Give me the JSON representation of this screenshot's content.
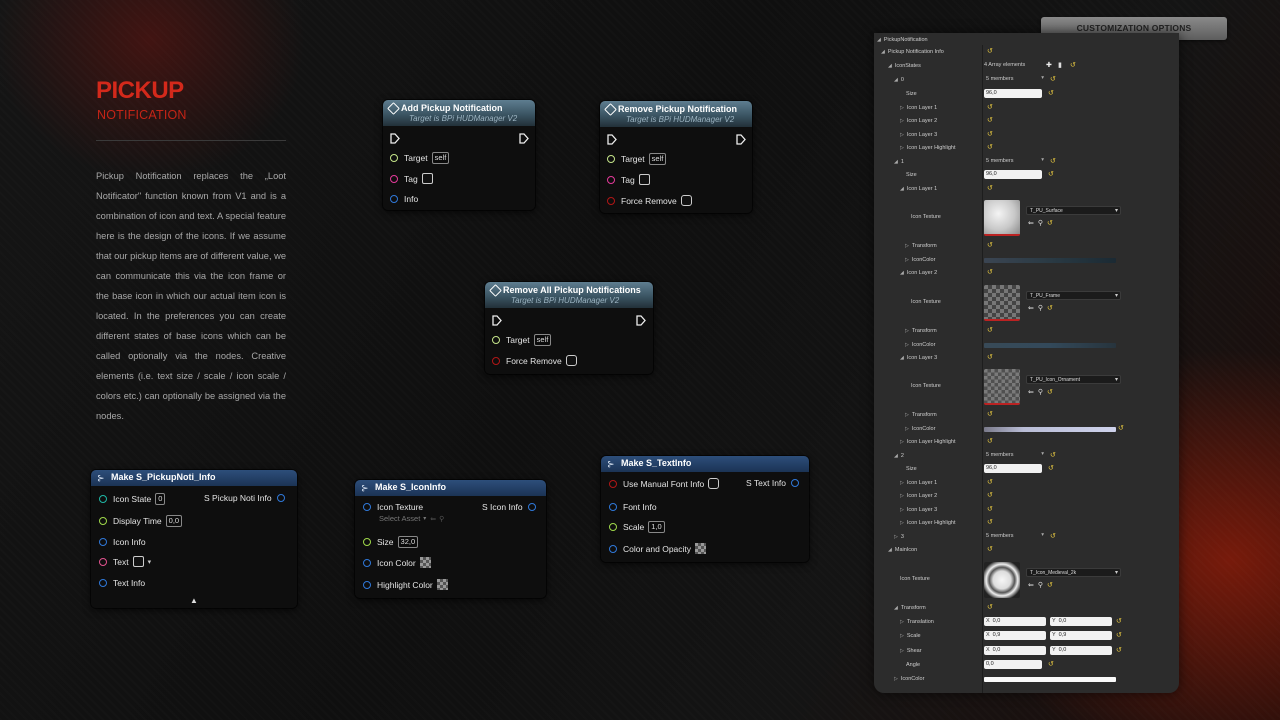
{
  "hero": {
    "title": "PICKUP",
    "subtitle": "NOTIFICATION",
    "description": "Pickup Notification replaces the „Loot Notificator\" function known from V1 and is a combination of icon and text. A special feature here is the design of the icons. If we assume that our pickup items are of different value, we can communicate this via the icon frame or the base icon in which our actual item icon is located. In the preferences you can create different states of base icons which can be called optionally via the nodes. Creative elements (i.e. text size / scale / icon scale / colors etc.) can optionally be assigned via the nodes."
  },
  "nodes": {
    "add": {
      "title": "Add Pickup Notification",
      "subtitle": "Target is BPi HUDManager V2",
      "target": "Target",
      "target_value": "self",
      "tag": "Tag",
      "info": "Info"
    },
    "remove": {
      "title": "Remove Pickup Notification",
      "subtitle": "Target is BPi HUDManager V2",
      "target": "Target",
      "target_value": "self",
      "tag": "Tag",
      "force": "Force Remove"
    },
    "remove_all": {
      "title": "Remove All Pickup Notifications",
      "subtitle": "Target is BPi HUDManager V2",
      "target": "Target",
      "target_value": "self",
      "force": "Force Remove"
    },
    "make_pickup": {
      "title": "Make S_PickupNoti_Info",
      "icon_state": "Icon State",
      "icon_state_value": "0",
      "display_time": "Display Time",
      "display_time_value": "0,0",
      "icon_info": "Icon Info",
      "text": "Text",
      "text_info": "Text Info",
      "output": "S Pickup Noti Info"
    },
    "make_icon": {
      "title": "Make S_IconInfo",
      "icon_texture": "Icon Texture",
      "select_asset": "Select Asset",
      "size": "Size",
      "size_value": "32,0",
      "icon_color": "Icon Color",
      "highlight_color": "Highlight Color",
      "output": "S Icon Info"
    },
    "make_text": {
      "title": "Make S_TextInfo",
      "use_manual": "Use Manual Font Info",
      "font_info": "Font Info",
      "scale": "Scale",
      "scale_value": "1,0",
      "color_opacity": "Color and Opacity",
      "output": "S Text Info"
    }
  },
  "top_button": "CUSTOMIZATION OPTIONS",
  "panel": {
    "header": "PickupNotification",
    "rows": {
      "pni": "Pickup Notification Info",
      "iconstates": "IconStates",
      "iconstates_val": "4 Array elements",
      "s0": "0",
      "s0_val": "5 members",
      "size": "Size",
      "size_val": "96,0",
      "layer1": "Icon Layer 1",
      "layer2": "Icon Layer 2",
      "layer3": "Icon Layer 3",
      "highlight": "Icon Layer Highlight",
      "s1": "1",
      "s1_val": "5 members",
      "icon_texture": "Icon Texture",
      "transform": "Transform",
      "iconcolor": "IconColor",
      "tex_surface": "T_PU_Surface",
      "tex_frame": "T_PU_Frame",
      "tex_orn": "T_PU_Icon_Ornament",
      "s2": "2",
      "s2_val": "5 members",
      "s3": "3",
      "s3_val": "5 members",
      "mainicon": "MainIcon",
      "tex_medieval": "T_Icon_Medieval_2k",
      "translation": "Translation",
      "scale": "Scale",
      "shear": "Shear",
      "angle": "Angle",
      "x": "X",
      "y": "Y",
      "tr_x": "0,0",
      "tr_y": "0,0",
      "sc_x": "0,9",
      "sc_y": "0,9",
      "sh_x": "0,0",
      "sh_y": "0,0",
      "angle_val": "0,0"
    }
  },
  "colors": {
    "accent": "#d3291b",
    "node_header": "#3b5563",
    "make_header": "#1b3355",
    "panel": "#2c2c2c",
    "reset": "#e3c540"
  }
}
